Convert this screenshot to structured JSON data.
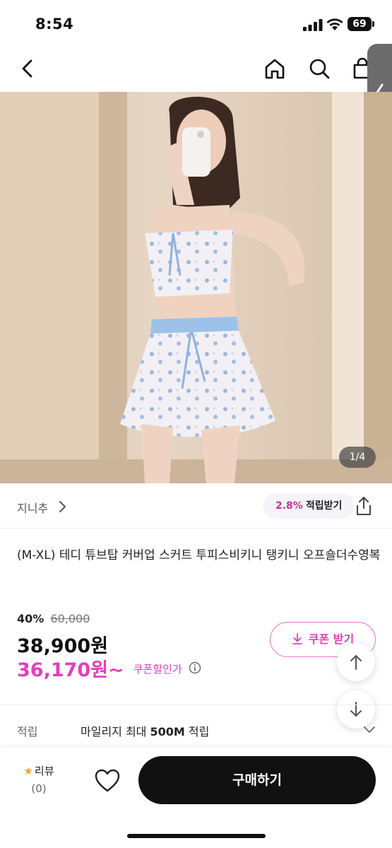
{
  "status_bar": {
    "time": "8:54",
    "battery": "69"
  },
  "nav": {
    "back_icon": "chevron-left-icon",
    "home_icon": "home-icon",
    "search_icon": "search-icon",
    "bag_icon": "shopping-bag-icon"
  },
  "image": {
    "counter": "1/4",
    "description_icon": "product-photo"
  },
  "seller": {
    "name": "지니추",
    "reward_rate": "2.8%",
    "reward_label": "적립받기"
  },
  "product": {
    "title": "(M-XL) 테디 튜브탑 커버업 스커트 투피스비키니 탱키니 오프숄더수영복"
  },
  "price": {
    "discount_rate": "40%",
    "original_price": "60,000",
    "sale_price": "38,900원",
    "coupon_price": "36,170원~",
    "coupon_price_label": "쿠폰할인가"
  },
  "coupon_button": {
    "label": "쿠폰 받기"
  },
  "points": {
    "label": "적립",
    "text_prefix": "마일리지 최대 ",
    "text_amount": "500M",
    "text_suffix": " 적립"
  },
  "bottom_bar": {
    "review_label": "리뷰",
    "review_count": "(0)",
    "buy_label": "구매하기"
  },
  "colors": {
    "accent_pink": "#e33fbb",
    "buy_button": "#111111"
  }
}
